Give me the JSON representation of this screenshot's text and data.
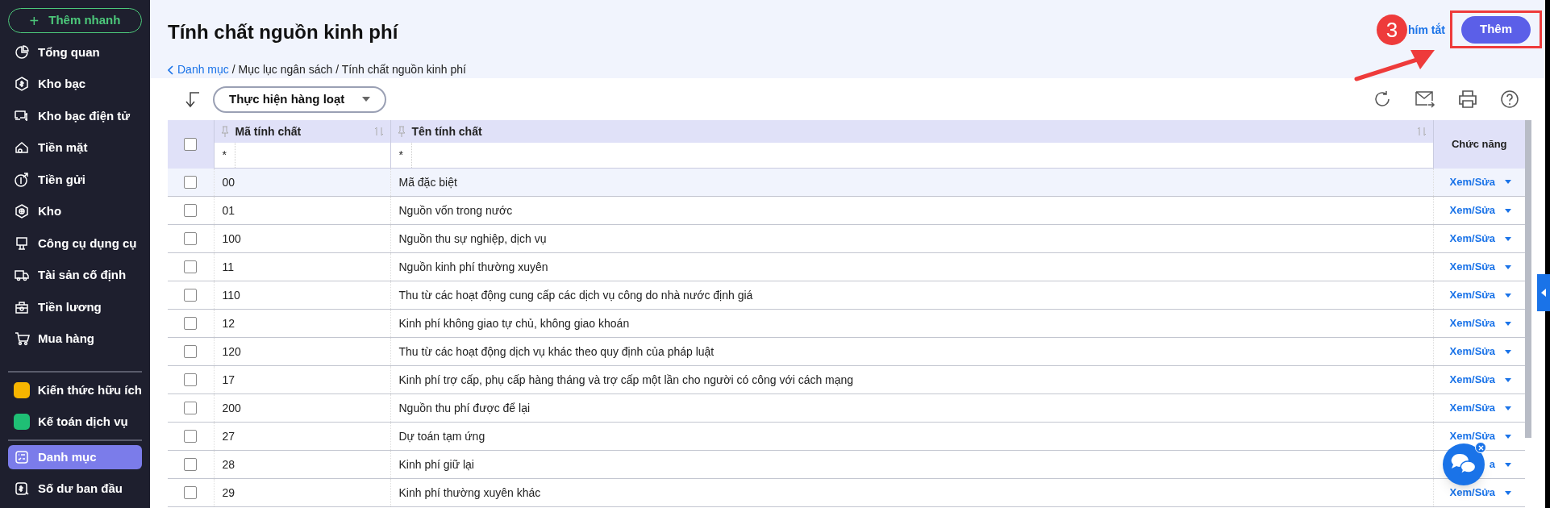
{
  "sidebar": {
    "quick_add": {
      "icon": "+",
      "label": "Thêm nhanh"
    },
    "items": [
      {
        "label": "Tổng quan",
        "selected": false
      },
      {
        "label": "Kho bạc",
        "selected": false
      },
      {
        "label": "Kho bạc điện tử",
        "selected": false
      },
      {
        "label": "Tiền mặt",
        "selected": false
      },
      {
        "label": "Tiền gửi",
        "selected": false
      },
      {
        "label": "Kho",
        "selected": false
      },
      {
        "label": "Công cụ dụng cụ",
        "selected": false
      },
      {
        "label": "Tài sản cố định",
        "selected": false
      },
      {
        "label": "Tiền lương",
        "selected": false
      },
      {
        "label": "Mua hàng",
        "selected": false
      }
    ],
    "extras": [
      {
        "label": "Kiến thức hữu ích",
        "color": "#f7b500"
      },
      {
        "label": "Kế toán dịch vụ",
        "color": "#1fbf75"
      }
    ],
    "bottom_items": [
      {
        "label": "Danh mục",
        "selected": true
      },
      {
        "label": "Số dư ban đầu",
        "selected": false
      }
    ]
  },
  "header": {
    "title": "Tính chất nguồn kinh phí",
    "breadcrumb": {
      "link": "Danh mục",
      "rest": "/ Mục lục ngân sách / Tính chất nguồn kinh phí"
    },
    "shortcut_link": "hím tắt",
    "add_button": "Thêm",
    "annotation_number": "3"
  },
  "toolbar": {
    "batch_button": "Thực hiện hàng loạt"
  },
  "table": {
    "all_checked": false,
    "columns": [
      "Mã tính chất",
      "Tên tính chất",
      "Chức năng"
    ],
    "filters": [
      "*",
      "*"
    ],
    "rows": [
      {
        "code": "00",
        "name": "Mã đặc biệt",
        "action": "Xem/Sửa",
        "highlighted": true
      },
      {
        "code": "01",
        "name": "Nguồn vốn trong nước",
        "action": "Xem/Sửa",
        "highlighted": false
      },
      {
        "code": "100",
        "name": "Nguồn thu sự nghiệp, dịch vụ",
        "action": "Xem/Sửa",
        "highlighted": false
      },
      {
        "code": "11",
        "name": "Nguồn kinh phí thường xuyên",
        "action": "Xem/Sửa",
        "highlighted": false
      },
      {
        "code": "110",
        "name": "Thu từ các hoạt động cung cấp các dịch vụ công do nhà nước định giá",
        "action": "Xem/Sửa",
        "highlighted": false
      },
      {
        "code": "12",
        "name": "Kinh phí không giao tự chủ, không giao khoán",
        "action": "Xem/Sửa",
        "highlighted": false
      },
      {
        "code": "120",
        "name": "Thu từ các hoạt động dịch vụ khác theo quy định của pháp luật",
        "action": "Xem/Sửa",
        "highlighted": false
      },
      {
        "code": "17",
        "name": "Kinh phí trợ cấp, phụ cấp hàng tháng và trợ cấp một lần cho người có công với cách mạng",
        "action": "Xem/Sửa",
        "highlighted": false
      },
      {
        "code": "200",
        "name": "Nguồn thu phí được để lại",
        "action": "Xem/Sửa",
        "highlighted": false
      },
      {
        "code": "27",
        "name": "Dự toán tạm ứng",
        "action": "Xem/Sửa",
        "highlighted": false
      },
      {
        "code": "28",
        "name": "Kinh phí giữ lại",
        "action": "a",
        "highlighted": false
      },
      {
        "code": "29",
        "name": "Kinh phí thường xuyên khác",
        "action": "Xem/Sửa",
        "highlighted": false
      }
    ]
  }
}
